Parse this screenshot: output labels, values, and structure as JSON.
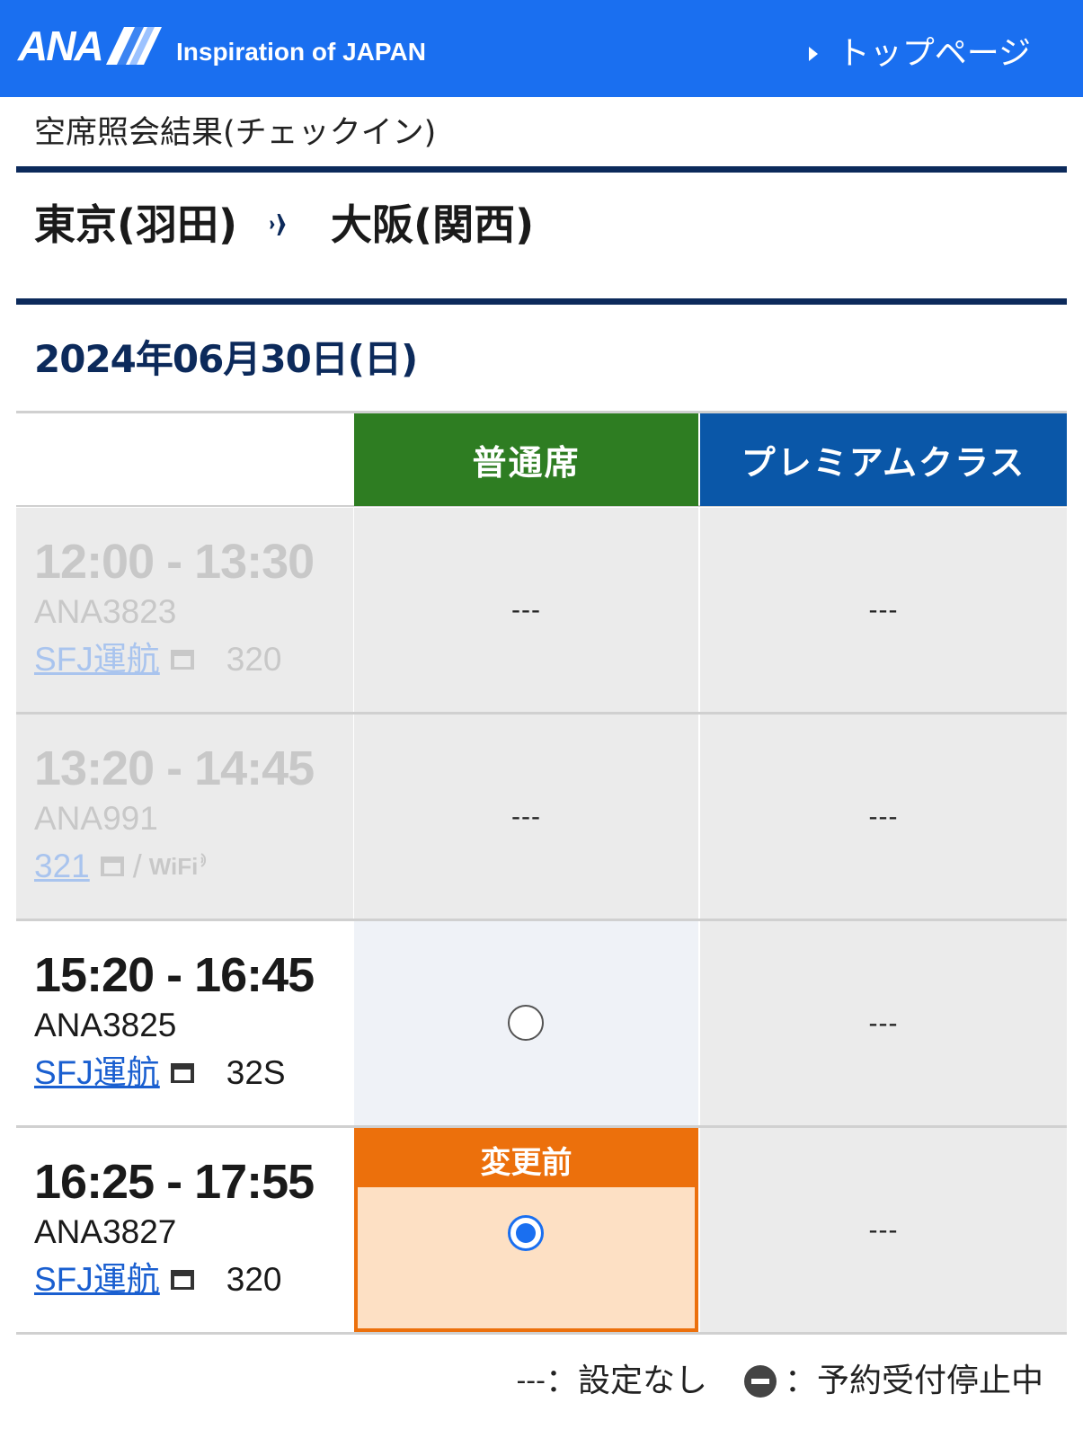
{
  "header": {
    "logo_text": "ANA",
    "tagline": "Inspiration of JAPAN",
    "top_link": "トップページ",
    "bg_color": "#1a6ff0"
  },
  "page_subtitle": "空席照会結果(チェックイン)",
  "route": {
    "origin": "東京(羽田)",
    "arrow_icon": "airplane-icon",
    "destination": "大阪(関西)"
  },
  "date": "2024年06月30日(日)",
  "columns": {
    "standard": {
      "label": "普通席",
      "color": "#2e7d22"
    },
    "premium": {
      "label": "プレミアムクラス",
      "color": "#0a57a8"
    }
  },
  "flights": [
    {
      "time": "12:00 - 13:30",
      "number": "ANA3823",
      "link": "SFJ運航",
      "aircraft": "320",
      "extras": "",
      "standard": "---",
      "premium": "---",
      "enabled": false
    },
    {
      "time": "13:20 - 14:45",
      "number": "ANA991",
      "link": "321",
      "aircraft": "",
      "extras": "WiFi",
      "standard": "---",
      "premium": "---",
      "enabled": false
    },
    {
      "time": "15:20 - 16:45",
      "number": "ANA3825",
      "link": "SFJ運航",
      "aircraft": "32S",
      "extras": "",
      "standard": "radio-unchecked",
      "premium": "---",
      "enabled": true
    },
    {
      "time": "16:25 - 17:55",
      "number": "ANA3827",
      "link": "SFJ運航",
      "aircraft": "320",
      "extras": "",
      "standard": "radio-checked",
      "standard_badge": "変更前",
      "premium": "---",
      "enabled": true
    }
  ],
  "legend": {
    "none_symbol": "---",
    "none_text": "：設定なし",
    "stop_icon": "minus-circle-icon",
    "stop_text": "：予約受付停止中"
  }
}
